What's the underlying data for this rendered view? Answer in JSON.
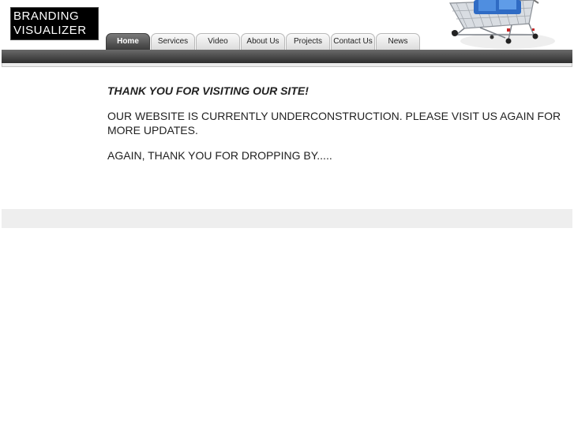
{
  "logo": {
    "line1": "BRANDING",
    "line2": "VISUALIZER"
  },
  "nav": {
    "tabs": [
      {
        "label": "Home",
        "active": true
      },
      {
        "label": "Services",
        "active": false
      },
      {
        "label": "Video",
        "active": false
      },
      {
        "label": "About Us",
        "active": false
      },
      {
        "label": "Projects",
        "active": false
      },
      {
        "label": "Contact Us",
        "active": false
      },
      {
        "label": "News",
        "active": false
      }
    ]
  },
  "header_image": {
    "icon": "shopping-cart-icon"
  },
  "content": {
    "thanks": "THANK YOU FOR VISITING OUR SITE!",
    "construction": "OUR WEBSITE IS CURRENTLY UNDERCONSTRUCTION. PLEASE VISIT US AGAIN FOR MORE UPDATES.",
    "again": "AGAIN, THANK YOU FOR DROPPING BY....."
  },
  "colors": {
    "navbar": "#3c3c3c",
    "active_tab": "#4a4a4a",
    "logo_bg": "#000000",
    "footer_band": "#eeeeee"
  }
}
